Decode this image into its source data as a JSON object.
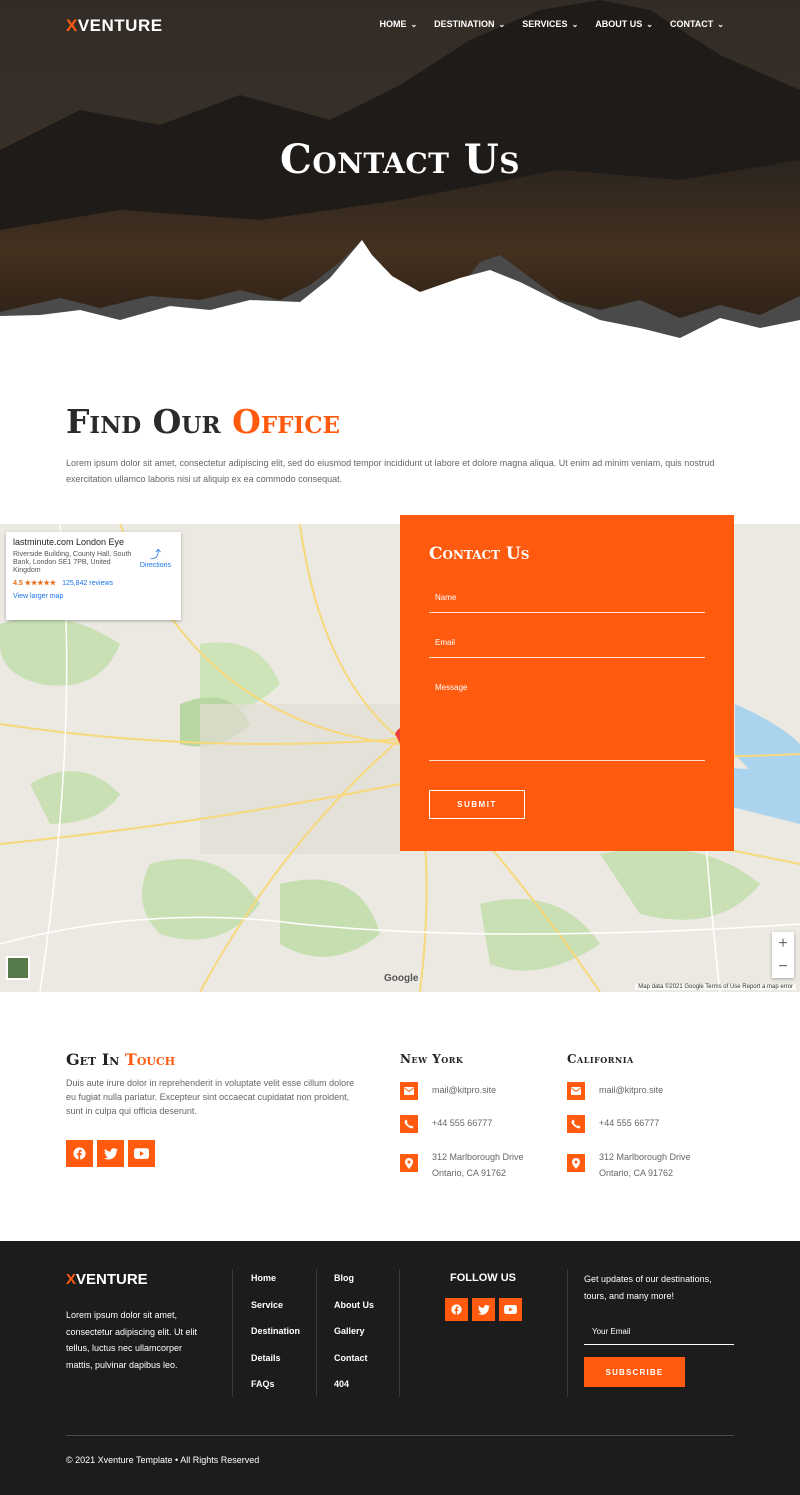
{
  "brand": {
    "logo_x": "X",
    "logo_rest": "VENTURE",
    "accent": "#ff5a0e"
  },
  "nav": {
    "items": [
      {
        "label": "HOME"
      },
      {
        "label": "DESTINATION"
      },
      {
        "label": "SERVICES"
      },
      {
        "label": "ABOUT US"
      },
      {
        "label": "CONTACT"
      }
    ]
  },
  "hero": {
    "title": "Contact Us"
  },
  "find": {
    "title_part1": "Find Our",
    "title_part2": "Office",
    "text": "Lorem ipsum dolor sit amet, consectetur adipiscing elit, sed do eiusmod tempor incididunt ut labore et dolore magna aliqua. Ut enim ad minim veniam, quis nostrud exercitation ullamco laboris nisi ut aliquip ex ea commodo consequat."
  },
  "map": {
    "place_name": "lastminute.com London Eye",
    "address": "Riverside Building, County Hall, South Bank, London SE1 7PB, United Kingdom",
    "rating": "4.5 ★★★★★",
    "reviews": "125,842 reviews",
    "view_larger": "View larger map",
    "directions": "Directions",
    "google": "Google",
    "footer": "Map data ©2021 Google   Terms of Use   Report a map error"
  },
  "form": {
    "title": "Contact Us",
    "name_placeholder": "Name",
    "email_placeholder": "Email",
    "message_placeholder": "Message",
    "submit": "SUBMIT"
  },
  "touch": {
    "title_part1": "Get In",
    "title_part2": "Touch",
    "text": "Duis aute irure dolor in reprehenderit in voluptate velit esse cillum dolore eu fugiat nulla pariatur. Excepteur sint occaecat cupidatat non proident, sunt in culpa qui officia deserunt."
  },
  "offices": [
    {
      "title": "New York",
      "email": "mail@kitpro.site",
      "phone": "+44 555 66777",
      "address_line1": "312 Marlborough Drive",
      "address_line2": "Ontario, CA 91762"
    },
    {
      "title": "California",
      "email": "mail@kitpro.site",
      "phone": "+44 555 66777",
      "address_line1": "312 Marlborough Drive",
      "address_line2": "Ontario, CA 91762"
    }
  ],
  "footer": {
    "about": "Lorem ipsum dolor sit amet, consectetur adipiscing elit. Ut elit tellus, luctus nec ullamcorper mattis, pulvinar dapibus leo.",
    "links_col1": [
      "Home",
      "Service",
      "Destination",
      "Details",
      "FAQs"
    ],
    "links_col2": [
      "Blog",
      "About Us",
      "Gallery",
      "Contact",
      "404"
    ],
    "follow_title": "FOLLOW US",
    "newsletter_text": "Get updates of our destinations, tours, and many more!",
    "newsletter_placeholder": "Your Email",
    "subscribe": "SUBSCRIBE",
    "copyright": "© 2021 Xventure Template • All Rights Reserved"
  },
  "icons": [
    "chevron-down-icon",
    "facebook-icon",
    "twitter-icon",
    "youtube-icon",
    "envelope-icon",
    "phone-icon",
    "map-pin-icon"
  ]
}
